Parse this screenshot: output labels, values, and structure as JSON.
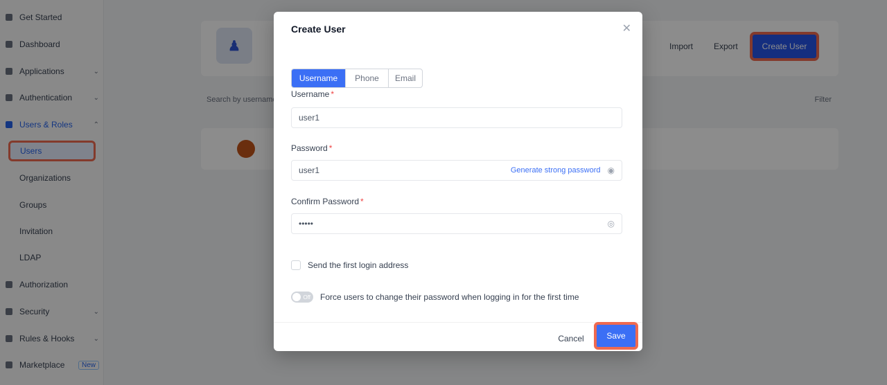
{
  "sidebar": {
    "items": [
      {
        "label": "Get Started",
        "icon": "rocket-icon"
      },
      {
        "label": "Dashboard",
        "icon": "dashboard-icon"
      },
      {
        "label": "Applications",
        "icon": "apps-icon"
      },
      {
        "label": "Authentication",
        "icon": "key-icon"
      },
      {
        "label": "Users & Roles",
        "icon": "users-icon"
      }
    ],
    "sub_items": {
      "users": "Users",
      "organizations": "Organizations",
      "groups": "Groups",
      "invitation": "Invitation",
      "ldap": "LDAP"
    },
    "lower_items": [
      {
        "label": "Authorization",
        "icon": "lock-icon"
      },
      {
        "label": "Security",
        "icon": "shield-icon"
      },
      {
        "label": "Rules & Hooks",
        "icon": "hook-icon"
      },
      {
        "label": "Marketplace",
        "icon": "store-icon",
        "badge": "New"
      }
    ]
  },
  "header": {
    "import_label": "Import",
    "export_label": "Export",
    "create_label": "Create User"
  },
  "table": {
    "search_placeholder": "Search by username",
    "filter_label": "Filter"
  },
  "modal": {
    "title": "Create User",
    "tabs": [
      "Username",
      "Phone",
      "Email"
    ],
    "username_label": "Username",
    "username_value": "user1",
    "password_label": "Password",
    "password_value": "user1",
    "generate_label": "Generate strong password",
    "confirm_label": "Confirm Password",
    "confirm_value": "•••••",
    "send_email_label": "Send the first login address",
    "force_change_label": "Force users to change their password when logging in for the first time",
    "switch_label": "Off",
    "cancel_label": "Cancel",
    "save_label": "Save"
  }
}
